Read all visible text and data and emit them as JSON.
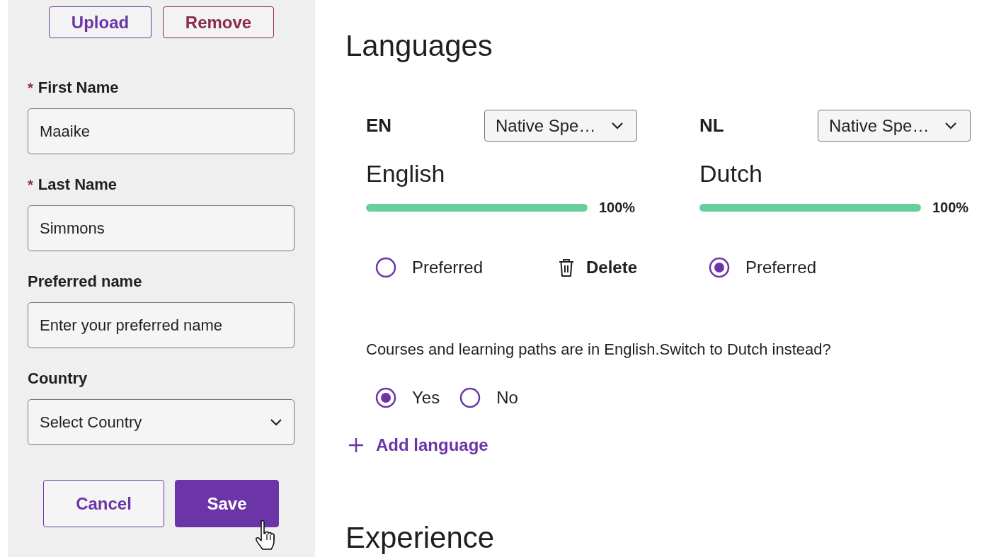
{
  "photo_actions": [
    {
      "label": "Upload",
      "kind": "primary"
    },
    {
      "label": "Remove",
      "kind": "danger"
    }
  ],
  "required_mark": "*",
  "fields": [
    {
      "label": "First Name",
      "required": true,
      "kind": "text",
      "value": "Maaike"
    },
    {
      "label": "Last Name",
      "required": true,
      "kind": "text",
      "value": "Simmons"
    },
    {
      "label": "Preferred name",
      "required": false,
      "kind": "text",
      "placeholder": "Enter your preferred name"
    },
    {
      "label": "Country",
      "required": false,
      "kind": "select",
      "value": "Select Country"
    }
  ],
  "form_buttons": [
    {
      "label": "Cancel",
      "kind": "secondary"
    },
    {
      "label": "Save",
      "kind": "primary"
    }
  ],
  "languages": {
    "title": "Languages",
    "items": [
      {
        "code": "EN",
        "proficiency": "Native Spe…",
        "name": "English",
        "level": 1,
        "reading": "100%",
        "preferred_label": "Preferred",
        "selected": false,
        "delete_label": "Delete"
      },
      {
        "code": "NL",
        "proficiency": "Native Spe…",
        "name": "Dutch",
        "level": 1,
        "reading": "100%",
        "preferred_label": "Preferred",
        "selected": true
      }
    ]
  },
  "switch_prompt": {
    "text": "Courses and learning paths are in English.Switch to Dutch instead?",
    "options": [
      {
        "label": "Yes",
        "selected": true
      },
      {
        "label": "No",
        "selected": false
      }
    ]
  },
  "add_language": "Add language",
  "next_section": {
    "title": "Experience"
  }
}
